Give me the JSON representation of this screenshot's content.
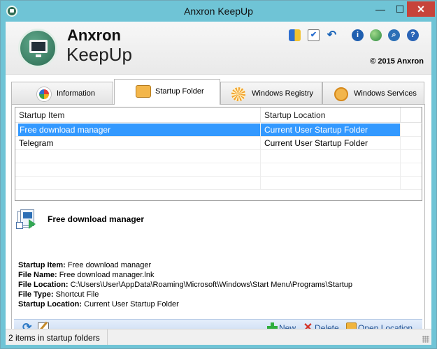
{
  "window": {
    "title": "Anxron KeepUp",
    "minimize": "—",
    "maximize": "☐",
    "close": "✕"
  },
  "header": {
    "brand_line1": "Anxron",
    "brand_line2": "KeepUp",
    "copyright": "© 2015 Anxron",
    "toolbar_icons": [
      "shield-icon",
      "checklist-icon",
      "undo-icon",
      "info-icon",
      "globe-icon",
      "search-icon",
      "help-icon"
    ],
    "info_glyph": "i",
    "help_glyph": "?",
    "undo_glyph": "↶",
    "check_glyph": "✔",
    "search_glyph": "⌕"
  },
  "tabs": [
    {
      "label": "Information",
      "active": false,
      "icon": "information-icon"
    },
    {
      "label": "Startup Folder",
      "active": true,
      "icon": "folder-icon"
    },
    {
      "label": "Windows Registry",
      "active": false,
      "icon": "registry-icon"
    },
    {
      "label": "Windows Services",
      "active": false,
      "icon": "services-icon"
    }
  ],
  "list": {
    "columns": [
      "Startup Item",
      "Startup Location"
    ],
    "rows": [
      {
        "item": "Free download manager",
        "location": "Current User Startup Folder",
        "selected": true
      },
      {
        "item": "Telegram",
        "location": "Current User Startup Folder",
        "selected": false
      }
    ]
  },
  "details": {
    "title": "Free download manager",
    "fields": [
      {
        "label": "Startup Item:",
        "value": "Free download manager"
      },
      {
        "label": "File Name:",
        "value": "Free download manager.lnk"
      },
      {
        "label": "File Location:",
        "value": "C:\\Users\\User\\AppData\\Roaming\\Microsoft\\Windows\\Start Menu\\Programs\\Startup"
      },
      {
        "label": "File Type:",
        "value": "Shortcut File"
      },
      {
        "label": "Startup Location:",
        "value": "Current User Startup Folder"
      }
    ]
  },
  "toolbar": {
    "refresh_glyph": "⟳",
    "new_label": "New",
    "delete_label": "Delete",
    "delete_glyph": "✕",
    "open_label": "Open Location"
  },
  "status": {
    "text": "2 items in startup folders"
  },
  "colors": {
    "titlebar": "#6fc4d6",
    "selection": "#3399ff",
    "close_button": "#c7433a",
    "link_text": "#1d4f91"
  }
}
